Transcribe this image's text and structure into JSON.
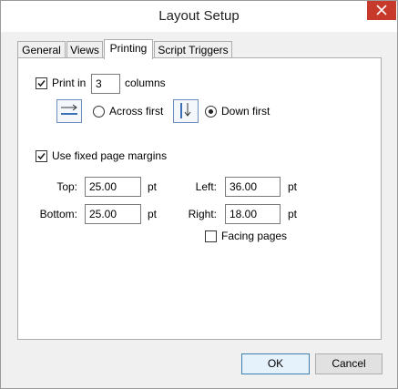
{
  "window": {
    "title": "Layout Setup"
  },
  "tabs": [
    {
      "label": "General"
    },
    {
      "label": "Views"
    },
    {
      "label": "Printing"
    },
    {
      "label": "Script Triggers"
    }
  ],
  "printing": {
    "print_in_label": "Print in",
    "columns_value": "3",
    "columns_label": "columns",
    "across_first_label": "Across first",
    "down_first_label": "Down first",
    "use_fixed_margins_label": "Use fixed page margins",
    "top_label": "Top:",
    "top_value": "25.00",
    "bottom_label": "Bottom:",
    "bottom_value": "25.00",
    "left_label": "Left:",
    "left_value": "36.00",
    "right_label": "Right:",
    "right_value": "18.00",
    "unit": "pt",
    "facing_pages_label": "Facing pages",
    "print_in_checked": true,
    "use_fixed_margins_checked": true,
    "facing_pages_checked": false,
    "selected_order": "down-first"
  },
  "buttons": {
    "ok": "OK",
    "cancel": "Cancel"
  }
}
